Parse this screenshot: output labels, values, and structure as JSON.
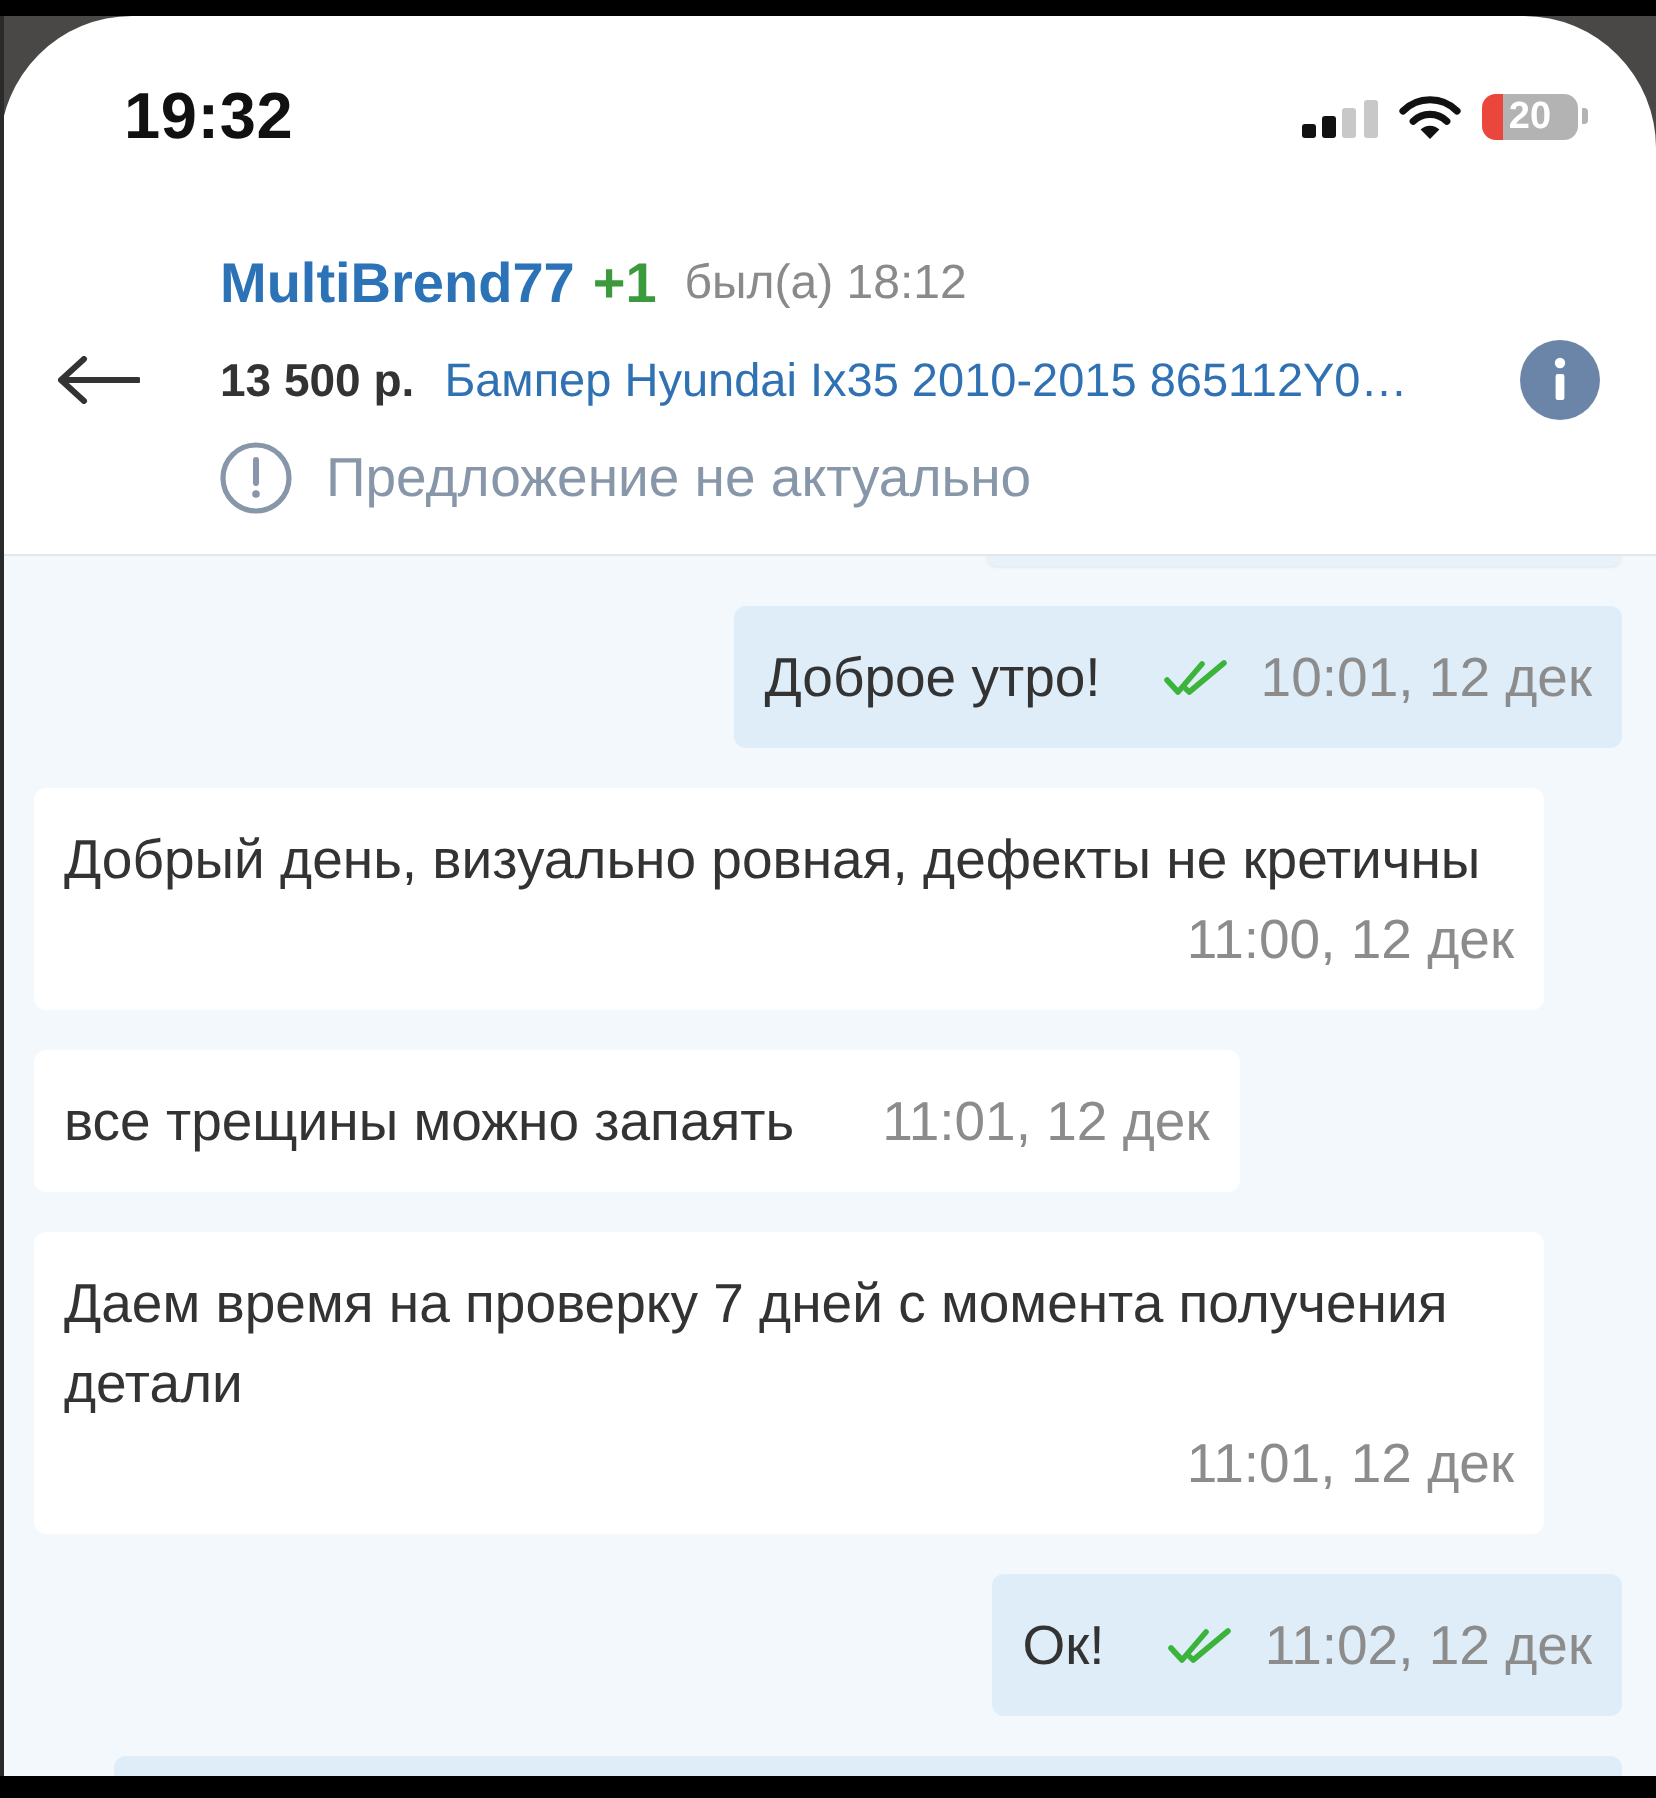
{
  "status_bar": {
    "time": "19:32",
    "battery": "20"
  },
  "header": {
    "contact": "MultiBrend77",
    "extra_count": "+1",
    "last_seen": "был(а) 18:12",
    "price": "13 500 р.",
    "listing_title": "Бампер Hyundai Ix35 2010-2015 865112Y0…",
    "notice": "Предложение не актуально"
  },
  "messages": [
    {
      "kind": "outgoing",
      "text": "Доброе утро!",
      "time": "10:01, 12 дек",
      "read": true
    },
    {
      "kind": "incoming",
      "text": "Добрый день, визуально ровная, дефекты не кретичны",
      "time": "11:00, 12 дек"
    },
    {
      "kind": "incoming",
      "text": "все трещины можно запаять",
      "time": "11:01, 12 дек"
    },
    {
      "kind": "incoming",
      "text": "Даем время на проверку 7 дней с момента получения детали",
      "time": "11:01, 12 дек"
    },
    {
      "kind": "outgoing",
      "text": "Ок!",
      "time": "11:02, 12 дек",
      "read": true
    }
  ]
}
